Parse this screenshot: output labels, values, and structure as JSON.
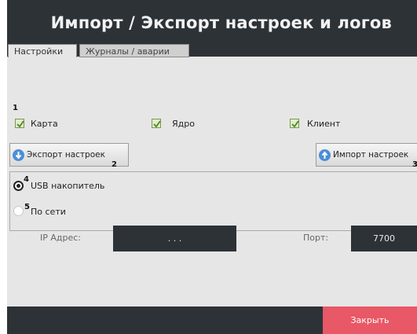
{
  "header": {
    "title": "Импорт / Экспорт настроек и логов"
  },
  "tabs": [
    {
      "label": "Настройки",
      "active": true
    },
    {
      "label": "Журналы / аварии",
      "active": false
    }
  ],
  "markers": {
    "n1": "1",
    "n2": "2",
    "n3": "3",
    "n4": "4",
    "n5": "5"
  },
  "checkboxes": [
    {
      "label": "Карта",
      "checked": true
    },
    {
      "label": "Ядро",
      "checked": true
    },
    {
      "label": "Клиент",
      "checked": true
    }
  ],
  "buttons": {
    "export_label": "Экспорт настроек",
    "import_label": "Импорт настроек"
  },
  "source": {
    "usb_label": "USB накопитель",
    "usb_selected": true,
    "network_label": "По сети",
    "network_selected": false
  },
  "network": {
    "ip_label": "IP Адрес:",
    "ip_value": ". . .",
    "port_label": "Порт:",
    "port_value": "7700"
  },
  "footer": {
    "close_label": "Закрыть"
  },
  "colors": {
    "header_bg": "#2d3237",
    "panel_bg": "#e6e6e6",
    "close_bg": "#e85866",
    "check_green": "#4f8a1e",
    "arrow_blue": "#4a8fd6"
  }
}
